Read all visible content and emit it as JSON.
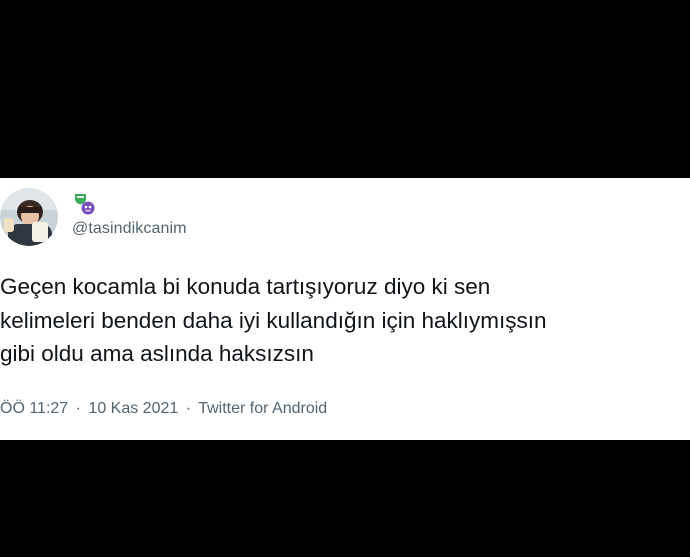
{
  "colors": {
    "background": "#000000",
    "card": "#ffffff",
    "text_primary": "#0f1419",
    "text_secondary": "#536471"
  },
  "tweet": {
    "handle": "@tasindikcanim",
    "avatar_icon": "profile-avatar",
    "badge_icons": [
      "green-shield-badge",
      "purple-mask-badge"
    ],
    "text_lines": [
      "Geçen kocamla bi konuda tartışıyoruz diyo ki sen",
      "kelimeleri benden daha iyi kullandığın için haklıymışsın",
      "gibi oldu ama aslında haksızsın"
    ],
    "time": "ÖÖ 11:27",
    "separator": "·",
    "date": "10 Kas 2021",
    "source": "Twitter for Android"
  }
}
